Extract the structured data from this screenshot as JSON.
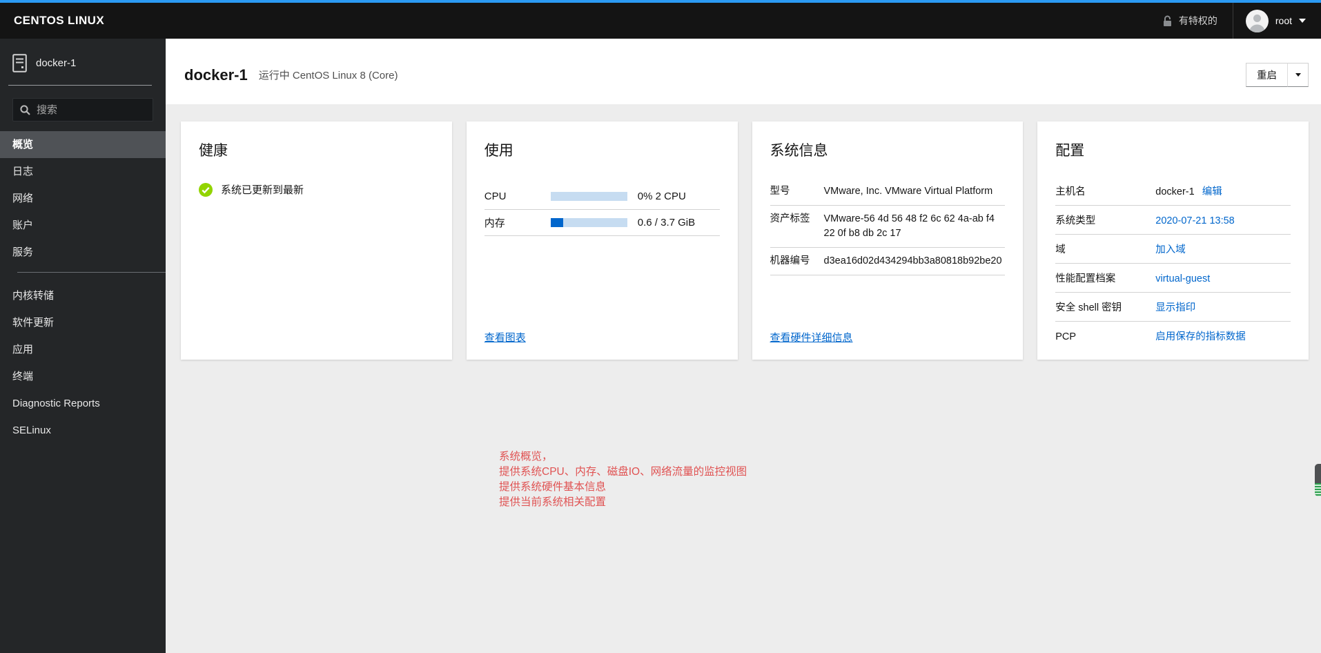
{
  "topbar": {
    "brand": "CENTOS LINUX",
    "privileged_label": "有特权的",
    "user": "root"
  },
  "sidebar": {
    "host": "docker-1",
    "search_placeholder": "搜索",
    "menu_primary": [
      {
        "label": "概览",
        "selected": true
      },
      {
        "label": "日志"
      },
      {
        "label": "网络"
      },
      {
        "label": "账户"
      },
      {
        "label": "服务"
      }
    ],
    "menu_secondary": [
      {
        "label": "内核转储"
      },
      {
        "label": "软件更新"
      },
      {
        "label": "应用"
      },
      {
        "label": "终端"
      },
      {
        "label": "Diagnostic Reports"
      },
      {
        "label": "SELinux"
      }
    ]
  },
  "header": {
    "hostname": "docker-1",
    "status": "运行中 CentOS Linux 8 (Core)",
    "restart_label": "重启"
  },
  "cards": {
    "health": {
      "title": "健康",
      "status_text": "系统已更新到最新"
    },
    "usage": {
      "title": "使用",
      "rows": [
        {
          "label": "CPU",
          "percent": 0,
          "value": "0% 2 CPU"
        },
        {
          "label": "内存",
          "percent": 16,
          "value": "0.6 / 3.7 GiB"
        }
      ],
      "link": "查看图表"
    },
    "system_info": {
      "title": "系统信息",
      "rows": [
        {
          "label": "型号",
          "value": "VMware, Inc. VMware Virtual Platform"
        },
        {
          "label": "资产标签",
          "value": "VMware-56 4d 56 48 f2 6c 62 4a-ab f4 22 0f b8 db 2c 17"
        },
        {
          "label": "机器编号",
          "value": "d3ea16d02d434294bb3a80818b92be20"
        }
      ],
      "link": "查看硬件详细信息"
    },
    "config": {
      "title": "配置",
      "rows": [
        {
          "label": "主机名",
          "value": "docker-1",
          "link": "编辑"
        },
        {
          "label": "系统类型",
          "link": "2020-07-21 13:58"
        },
        {
          "label": "域",
          "link": "加入域"
        },
        {
          "label": "性能配置档案",
          "link": "virtual-guest"
        },
        {
          "label": "安全 shell 密钥",
          "link": "显示指印"
        },
        {
          "label": "PCP",
          "link": "启用保存的指标数据"
        }
      ]
    }
  },
  "annotation": {
    "lines": [
      "系统概览，",
      "提供系统CPU、内存、磁盘IO、网络流量的监控视图",
      "提供系统硬件基本信息",
      "提供当前系统相关配置"
    ]
  },
  "colors": {
    "accent_blue": "#2b9af3",
    "link_blue": "#0066cc",
    "success_green": "#92d400",
    "annotation_red": "#e05252",
    "bar_fill": "#0066cc",
    "bar_track": "#c6dcf1",
    "sidebar_selected": "#4f5256",
    "topbar_bg": "#141414",
    "sidebar_bg": "#242628"
  }
}
